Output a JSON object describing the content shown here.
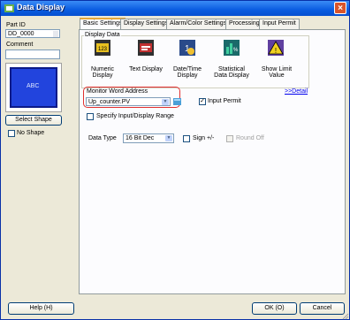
{
  "window": {
    "title": "Data Display"
  },
  "left_panel": {
    "part_id_label": "Part ID",
    "part_id_value": "DD_0000",
    "comment_label": "Comment",
    "comment_value": "",
    "preview_text": "ABC",
    "select_shape_label": "Select Shape",
    "no_shape_label": "No Shape"
  },
  "tabs": [
    {
      "label": "Basic Settings"
    },
    {
      "label": "Display Settings"
    },
    {
      "label": "Alarm/Color Settings"
    },
    {
      "label": "Processing"
    },
    {
      "label": "Input Permit"
    }
  ],
  "display_data": {
    "label": "Display Data",
    "items": [
      {
        "label": "Numeric Display",
        "icon": "numeric-display-icon"
      },
      {
        "label": "Text Display",
        "icon": "text-display-icon"
      },
      {
        "label": "Date/Time Display",
        "icon": "datetime-display-icon"
      },
      {
        "label": "Statistical Data Display",
        "icon": "statistical-display-icon"
      },
      {
        "label": "Show Limit Value",
        "icon": "show-limit-value-icon"
      }
    ]
  },
  "basic": {
    "monitor_word_label": "Monitor Word Address",
    "monitor_word_value": "Up_counter.PV",
    "detail_link": ">>Detail",
    "input_permit_label": "Input Permit",
    "input_permit_checked": true,
    "specify_range_label": "Specify Input/Display Range",
    "data_type_label": "Data Type",
    "data_type_value": "16 Bit Dec",
    "sign_label": "Sign +/-",
    "round_off_label": "Round Off"
  },
  "footer": {
    "help_label": "Help (H)",
    "ok_label": "OK (O)",
    "cancel_label": "Cancel"
  },
  "colors": {
    "preview_bg": "#2244dd",
    "highlight": "#e03030",
    "title_bar": "#0a5ce0"
  }
}
